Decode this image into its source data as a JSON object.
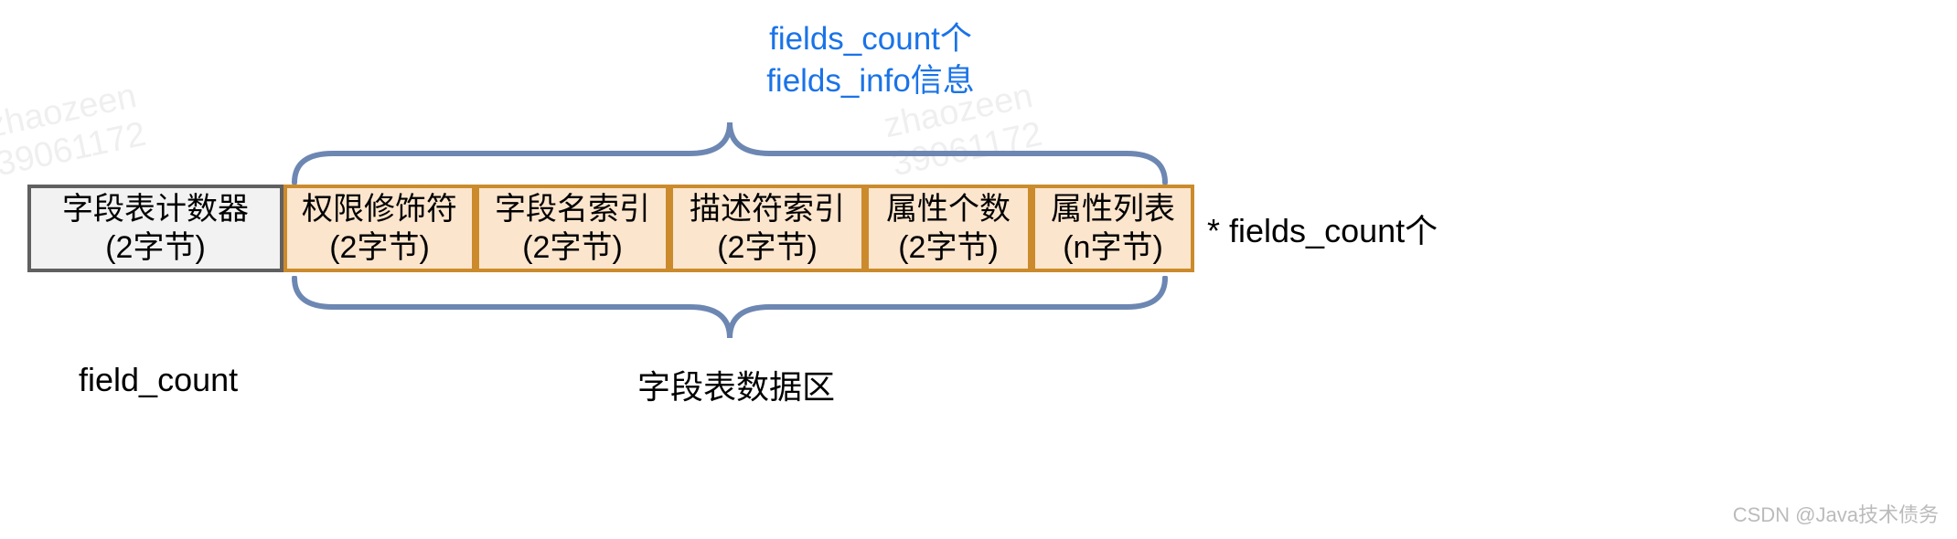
{
  "annotation_top": {
    "line1": "fields_count个",
    "line2": "fields_info信息"
  },
  "boxes": {
    "counter": {
      "title": "字段表计数器",
      "size": "(2字节)"
    },
    "access": {
      "title": "权限修饰符",
      "size": "(2字节)"
    },
    "name_index": {
      "title": "字段名索引",
      "size": "(2字节)"
    },
    "descriptor_index": {
      "title": "描述符索引",
      "size": "(2字节)"
    },
    "attributes_count": {
      "title": "属性个数",
      "size": "(2字节)"
    },
    "attributes_list": {
      "title": "属性列表",
      "size": "(n字节)"
    }
  },
  "multiplier_label": "* fields_count个",
  "labels": {
    "bottom_left": "field_count",
    "bottom_center": "字段表数据区"
  },
  "watermark": {
    "name": "zhaozeen",
    "number": "39061172"
  },
  "attribution": "CSDN @Java技术债务"
}
